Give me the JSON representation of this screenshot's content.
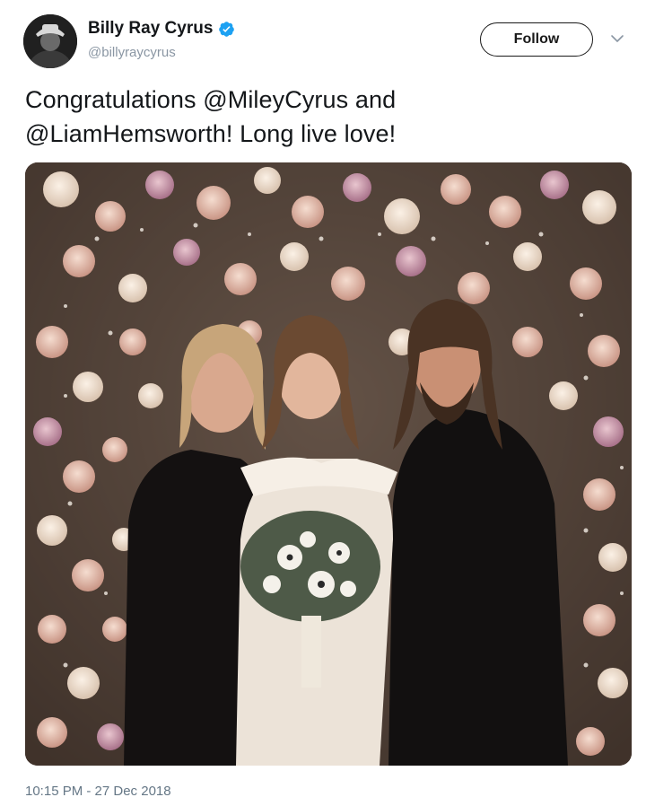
{
  "tweet": {
    "author": {
      "display_name": "Billy Ray Cyrus",
      "handle": "@billyraycyrus",
      "verified": true,
      "avatar_icon": "profile-avatar"
    },
    "follow_label": "Follow",
    "menu_icon": "chevron-down-icon",
    "text_line1": "Congratulations @MileyCyrus and",
    "text_line2": "@LiamHemsworth! Long live love!",
    "photo": {
      "description_icon": "wedding-photo"
    },
    "timestamp": "10:15 PM - 27 Dec 2018"
  },
  "colors": {
    "verified_blue": "#1da1f2",
    "text": "#14171a",
    "secondary": "#8a96a3",
    "timestamp": "#657786"
  }
}
